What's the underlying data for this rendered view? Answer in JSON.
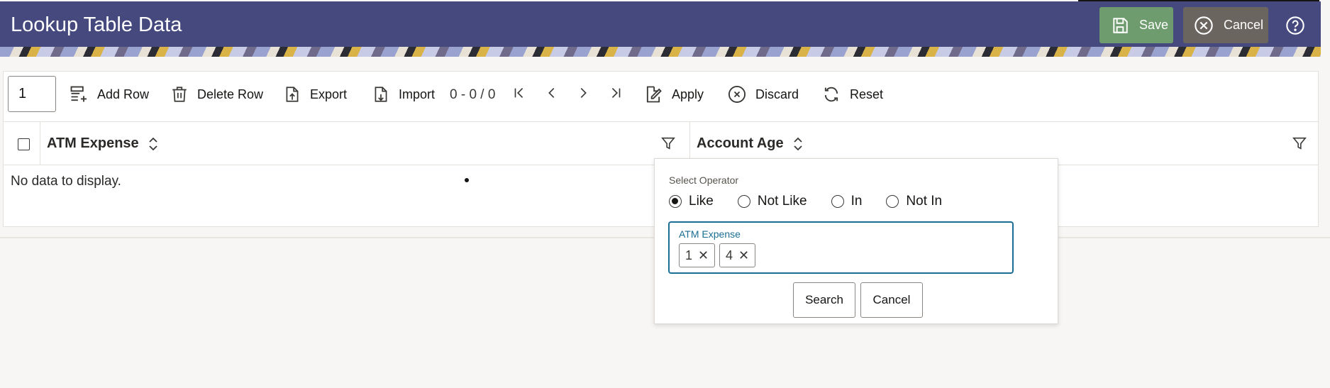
{
  "header": {
    "title": "Lookup Table Data",
    "save_label": "Save",
    "cancel_label": "Cancel",
    "help_icon": "help-circle-icon",
    "colors": {
      "header_bg": "#46497e",
      "save_bg": "#6e9c6e",
      "cancel_bg": "#6b6560"
    }
  },
  "toolbar": {
    "page_value": "1",
    "add_row_label": "Add Row",
    "delete_row_label": "Delete Row",
    "export_label": "Export",
    "import_label": "Import",
    "range_text": "0 - 0 / 0",
    "apply_label": "Apply",
    "discard_label": "Discard",
    "reset_label": "Reset"
  },
  "table": {
    "columns": [
      {
        "label": "ATM Expense"
      },
      {
        "label": "Account Age"
      }
    ],
    "empty_text": "No data to display."
  },
  "filter_popup": {
    "operator_label": "Select Operator",
    "operators": [
      {
        "label": "Like",
        "selected": true
      },
      {
        "label": "Not Like",
        "selected": false
      },
      {
        "label": "In",
        "selected": false
      },
      {
        "label": "Not In",
        "selected": false
      }
    ],
    "field_label": "ATM Expense",
    "chips": [
      "1",
      "4"
    ],
    "search_label": "Search",
    "cancel_label": "Cancel",
    "accent_color": "#1a6e93"
  }
}
